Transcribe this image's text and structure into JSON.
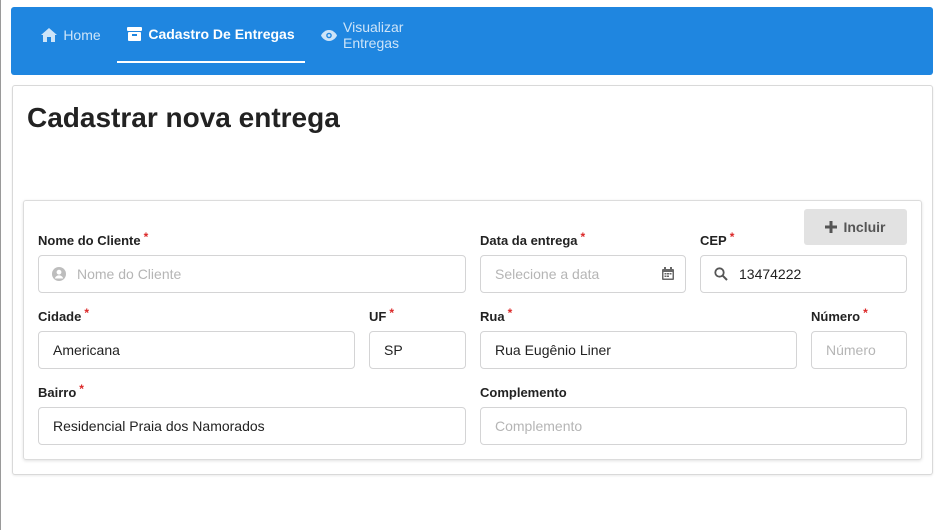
{
  "nav": {
    "items": [
      {
        "label": "Home",
        "icon": "home-icon",
        "active": false
      },
      {
        "label": "Cadastro De Entregas",
        "icon": "box-icon",
        "active": true
      },
      {
        "label": "Visualizar Entregas",
        "icon": "eye-icon",
        "active": false
      }
    ],
    "color": "#1f86e0"
  },
  "page": {
    "title": "Cadastrar nova entrega"
  },
  "form": {
    "include_button": "Incluir",
    "required_mark": "*",
    "fields": {
      "cliente": {
        "label": "Nome do Cliente",
        "placeholder": "Nome do Cliente",
        "value": ""
      },
      "data": {
        "label": "Data da entrega",
        "placeholder": "Selecione a data",
        "value": ""
      },
      "cep": {
        "label": "CEP",
        "placeholder": "",
        "value": "13474222"
      },
      "cidade": {
        "label": "Cidade",
        "placeholder": "",
        "value": "Americana"
      },
      "uf": {
        "label": "UF",
        "placeholder": "",
        "value": "SP"
      },
      "rua": {
        "label": "Rua",
        "placeholder": "",
        "value": "Rua Eugênio Liner"
      },
      "numero": {
        "label": "Número",
        "placeholder": "Número",
        "value": ""
      },
      "bairro": {
        "label": "Bairro",
        "placeholder": "",
        "value": "Residencial Praia dos Namorados"
      },
      "complemento": {
        "label": "Complemento",
        "placeholder": "Complemento",
        "value": ""
      }
    }
  }
}
